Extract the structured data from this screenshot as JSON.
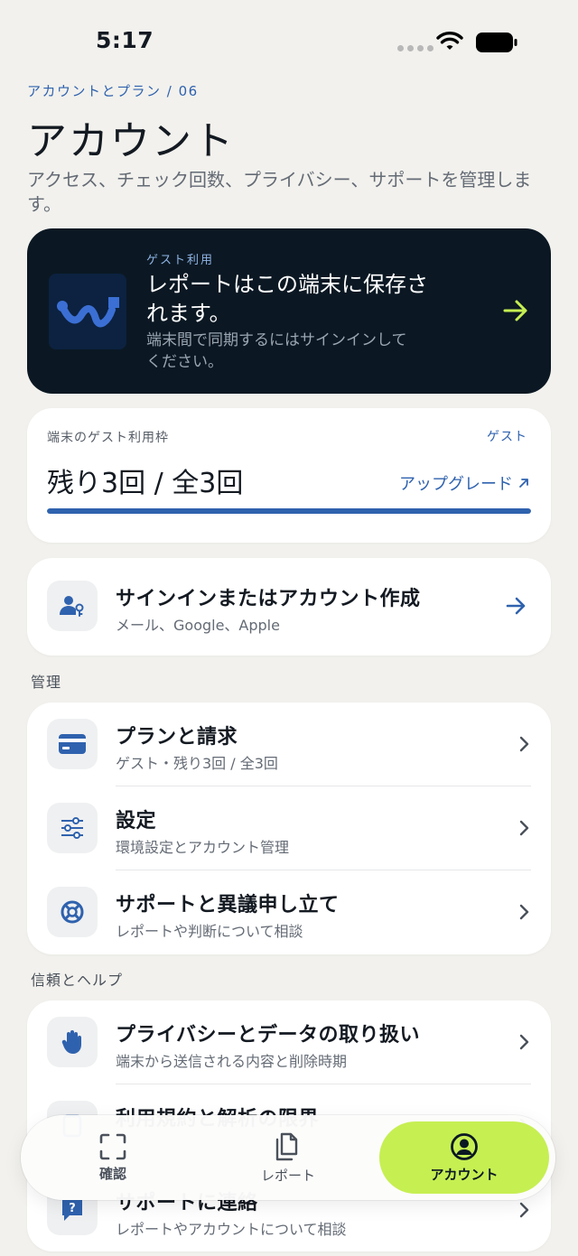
{
  "status_bar": {
    "time": "5:17"
  },
  "header": {
    "breadcrumb": "アカウントとプラン / 06",
    "title": "アカウント",
    "subtitle": "アクセス、チェック回数、プライバシー、サポートを管理します。"
  },
  "guest_card": {
    "kicker": "ゲスト利用",
    "title": "レポートはこの端末に保存されます。",
    "description": "端末間で同期するにはサインインしてください。",
    "accent_color": "#c6ef52"
  },
  "quota": {
    "label": "端末のゲスト利用枠",
    "badge": "ゲスト",
    "value_text": "残り3回 / 全3回",
    "upgrade_label": "アップグレード",
    "remaining": 3,
    "total": 3,
    "fill_fraction": 1.0
  },
  "signin": {
    "title": "サインインまたはアカウント作成",
    "subtitle": "メール、Google、Apple",
    "icon": "user-key-icon"
  },
  "manage": {
    "section_label": "管理",
    "items": [
      {
        "title": "プランと請求",
        "subtitle": "ゲスト・残り3回 / 全3回",
        "icon": "credit-card-icon"
      },
      {
        "title": "設定",
        "subtitle": "環境設定とアカウント管理",
        "icon": "sliders-icon"
      },
      {
        "title": "サポートと異議申し立て",
        "subtitle": "レポートや判断について相談",
        "icon": "lifebuoy-icon"
      }
    ]
  },
  "trust": {
    "section_label": "信頼とヘルプ",
    "items": [
      {
        "title": "プライバシーとデータの取り扱い",
        "subtitle": "端末から送信される内容と削除時期",
        "icon": "hand-icon"
      },
      {
        "title": "利用規約と解析の限界",
        "subtitle": "",
        "icon": "document-icon"
      },
      {
        "title": "サポートに連絡",
        "subtitle": "レポートやアカウントについて相談",
        "icon": "help-chat-icon"
      }
    ]
  },
  "bottom_nav": {
    "items": [
      {
        "label": "確認",
        "icon": "scan-icon",
        "active": false
      },
      {
        "label": "レポート",
        "icon": "documents-icon",
        "active": false
      },
      {
        "label": "アカウント",
        "icon": "account-icon",
        "active": true
      }
    ]
  },
  "colors": {
    "accent_blue": "#2f62ae",
    "dark_card": "#0b1823",
    "lime": "#c6ef52",
    "background": "#f2f1ed"
  }
}
